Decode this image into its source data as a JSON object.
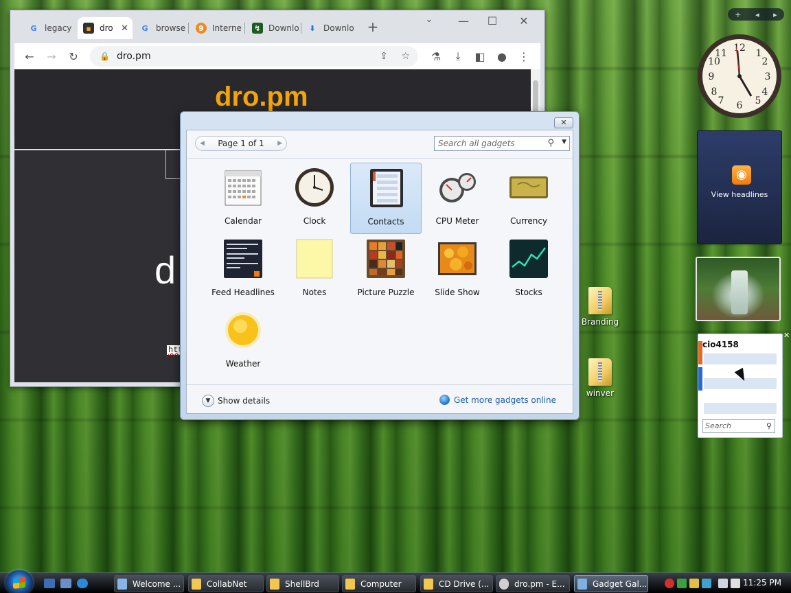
{
  "browser": {
    "tabs": [
      {
        "label": "legacy",
        "favicon": "google-icon"
      },
      {
        "label": "dro",
        "favicon": "dropm-icon"
      },
      {
        "label": "browse",
        "favicon": "google-icon"
      },
      {
        "label": "Interne",
        "favicon": "ie-site-icon"
      },
      {
        "label": "Downlo",
        "favicon": "download-site-icon"
      },
      {
        "label": "Downlo",
        "favicon": "download-icon"
      }
    ],
    "new_tab_label": "+",
    "url": "dro.pm",
    "page": {
      "logo": "dro.pm",
      "big_text": "d",
      "input_text": "htt"
    }
  },
  "gallery": {
    "close_label": "✕",
    "pager_label": "Page 1 of 1",
    "search_placeholder": "Search all gadgets",
    "gadgets": [
      {
        "label": "Calendar"
      },
      {
        "label": "Clock"
      },
      {
        "label": "Contacts"
      },
      {
        "label": "CPU Meter"
      },
      {
        "label": "Currency"
      },
      {
        "label": "Feed Headlines"
      },
      {
        "label": "Notes"
      },
      {
        "label": "Picture Puzzle"
      },
      {
        "label": "Slide Show"
      },
      {
        "label": "Stocks"
      },
      {
        "label": "Weather"
      }
    ],
    "selected": "Contacts",
    "show_details": "Show details",
    "get_more": "Get more gadgets online"
  },
  "sidebar": {
    "controls": {
      "add": "+",
      "prev": "◂",
      "next": "▸"
    },
    "feed_label": "View headlines",
    "contacts_name": "cio4158",
    "contacts_search_placeholder": "Search"
  },
  "desktop_icons": [
    {
      "label": "Branding"
    },
    {
      "label": "winver"
    }
  ],
  "taskbar": {
    "buttons": [
      {
        "label": "Welcome ..."
      },
      {
        "label": "CollabNet"
      },
      {
        "label": "ShellBrd"
      },
      {
        "label": "Computer"
      },
      {
        "label": "CD Drive (..."
      },
      {
        "label": "dro.pm - E..."
      },
      {
        "label": "Gadget Gal..."
      }
    ],
    "active_button": "Gadget Gal...",
    "clock": "11:25 PM"
  },
  "colors": {
    "accent_orange": "#f2a40a",
    "link_blue": "#1d5fb4",
    "selection_blue": "#c3dbf4"
  }
}
